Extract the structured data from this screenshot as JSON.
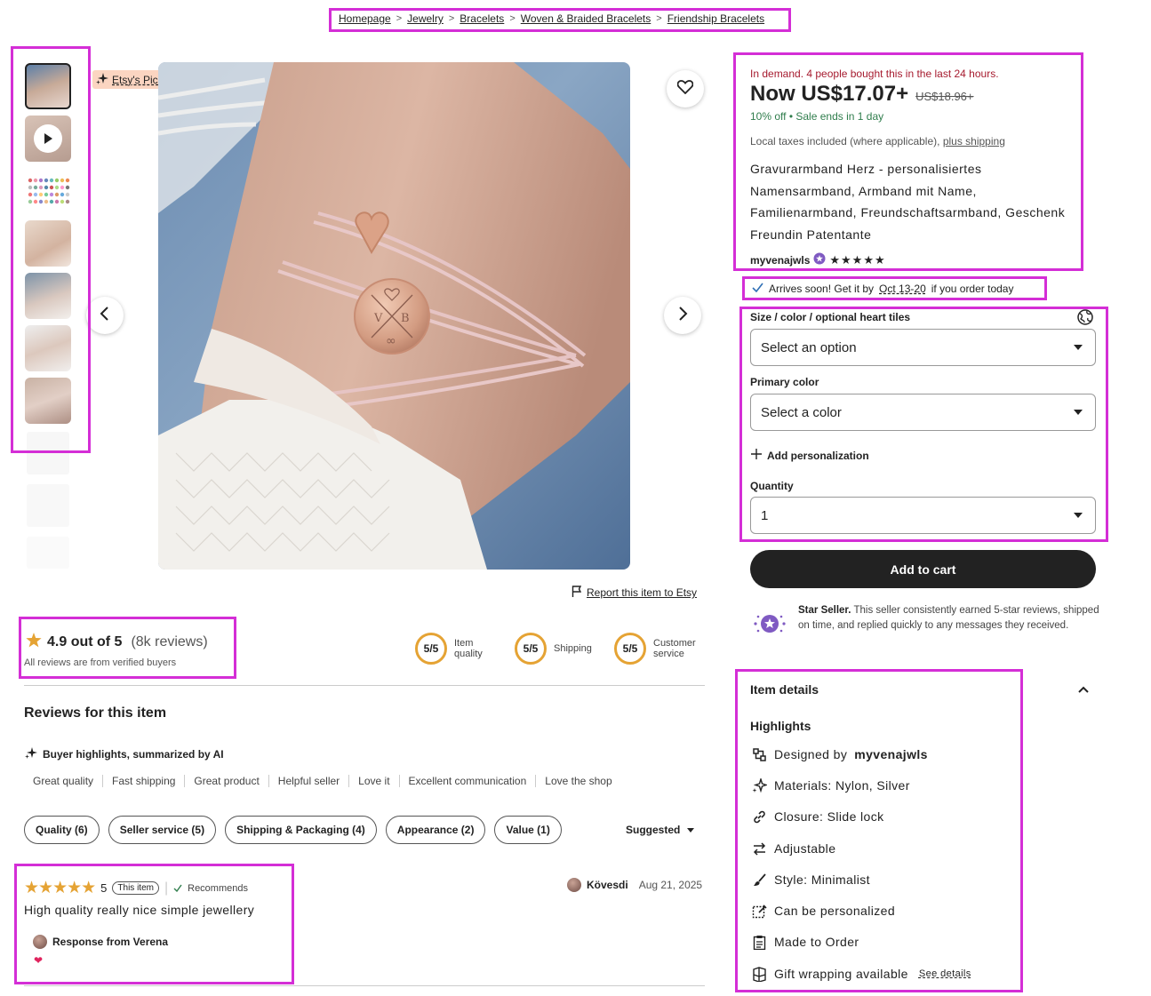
{
  "breadcrumb": [
    "Homepage",
    "Jewelry",
    "Bracelets",
    "Woven & Braided Bracelets",
    "Friendship Bracelets"
  ],
  "badge": {
    "label": "Etsy's Pick"
  },
  "listing": {
    "demand": "In demand. 4 people bought this in the last 24 hours.",
    "price_now": "Now US$17.07+",
    "price_old": "US$18.96+",
    "discount": "10% off",
    "sale_end": "Sale ends in 1 day",
    "taxes": "Local taxes included (where applicable),",
    "shipping_link": "plus shipping",
    "title": "Gravurarmband Herz - personalisiertes Namensarmband, Armband mit Name, Familienarmband, Freundschaftsarmband, Geschenk Freundin Patentante",
    "seller": "myvenajwls",
    "seller_stars": "★★★★★",
    "arrives_prefix": "Arrives soon! Get it by",
    "arrives_dates": "Oct 13-20",
    "arrives_suffix": "if you order today"
  },
  "options": {
    "size_label": "Size / color / optional heart tiles",
    "size_value": "Select an option",
    "color_label": "Primary color",
    "color_value": "Select a color",
    "personalization": "Add personalization",
    "quantity_label": "Quantity",
    "quantity_value": "1",
    "add_to_cart": "Add to cart"
  },
  "star_seller": {
    "title": "Star Seller.",
    "text": "This seller consistently earned 5-star reviews, shipped on time, and replied quickly to any messages they received."
  },
  "details": {
    "heading": "Item details",
    "highlights": "Highlights",
    "designed_prefix": "Designed by",
    "designed_by": "myvenajwls",
    "materials": "Materials: Nylon, Silver",
    "closure": "Closure: Slide lock",
    "adjustable": "Adjustable",
    "style": "Style: Minimalist",
    "personalized": "Can be personalized",
    "made_to_order": "Made to Order",
    "gift": "Gift wrapping available",
    "see_details": "See details"
  },
  "report": "Report this item to Etsy",
  "reviews": {
    "rating": "4.9 out of 5",
    "count": "(8k reviews)",
    "verified": "All reviews are from verified buyers",
    "scores": [
      {
        "value": "5/5",
        "label": "Item quality"
      },
      {
        "value": "5/5",
        "label": "Shipping"
      },
      {
        "value": "5/5",
        "label": "Customer service"
      }
    ],
    "heading": "Reviews for this item",
    "ai_label": "Buyer highlights, summarized by AI",
    "highlights": [
      "Great quality",
      "Fast shipping",
      "Great product",
      "Helpful seller",
      "Love it",
      "Excellent communication",
      "Love the shop"
    ],
    "filters": [
      "Quality (6)",
      "Seller service (5)",
      "Shipping & Packaging (4)",
      "Appearance (2)",
      "Value (1)"
    ],
    "sort": "Suggested",
    "first": {
      "stars": "★★★★★",
      "rating": "5",
      "tag": "This item",
      "recommends": "Recommends",
      "text": "High quality really nice simple jewellery",
      "response": "Response from Verena",
      "reaction": "❤",
      "author": "Kövesdi",
      "date": "Aug 21, 2025"
    }
  },
  "colors": {
    "highlight": "#d42ed6",
    "demand": "#a61a2e",
    "sale": "#2f7d4c",
    "star": "#e5a334"
  }
}
